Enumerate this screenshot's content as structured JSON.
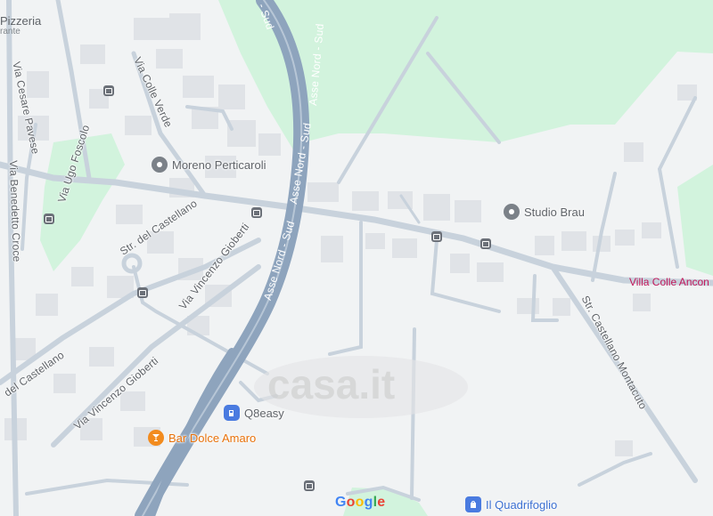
{
  "map": {
    "colors": {
      "background": "#f1f3f4",
      "park": "#d2f3dd",
      "road": "#c8d2dc",
      "highway": "#8ea4bd",
      "building": "#e0e3e7"
    }
  },
  "roads": {
    "via_cesare_pavese": "Via Cesare Pavese",
    "via_colle_verde": "Via Colle Verde",
    "via_ugo_foscolo": "Via Ugo Foscolo",
    "via_benedetto_croce": "Via Benedetto Croce",
    "str_del_castellano": "Str. del Castellano",
    "via_vincenzo_gioberti_1": "Via Vincenzo Gioberti",
    "via_vincenzo_gioberti_2": "Via Vincenzo Gioberti",
    "del_castellano": "del Castellano",
    "asse_nord_sud_1": "Asse Nord - Sud",
    "asse_nord_sud_2": "Asse Nord - Sud",
    "asse_nord_sud_3": "Asse Nord - Sud",
    "asse_nord_sud_4": "Asse Nord - Sud",
    "str_castellano_montacuto": "Str. Castellano Montacuto",
    "top_label": "- Sud"
  },
  "places": {
    "pizzeria": "Pizzeria",
    "ristorante_partial": "rante",
    "moreno_perticaroli": "Moreno Perticaroli",
    "studio_brau": "Studio Brau",
    "villa_colle_ancona": "Villa Colle Ancon",
    "q8easy": "Q8easy",
    "bar_dolce_amaro": "Bar Dolce Amaro",
    "il_quadrifoglio": "Il Quadrifoglio"
  },
  "icons": {
    "generic_pin": "place-pin-icon",
    "fuel": "fuel-station-icon",
    "bar": "cocktail-icon",
    "shop": "shopping-bag-icon",
    "bus": "bus-stop-icon"
  },
  "watermark": "casa.it",
  "attribution": {
    "letters": [
      "G",
      "o",
      "o",
      "g",
      "l",
      "e"
    ],
    "letter_colors": [
      "#4285f4",
      "#ea4335",
      "#fbbc05",
      "#4285f4",
      "#34a853",
      "#ea4335"
    ]
  }
}
